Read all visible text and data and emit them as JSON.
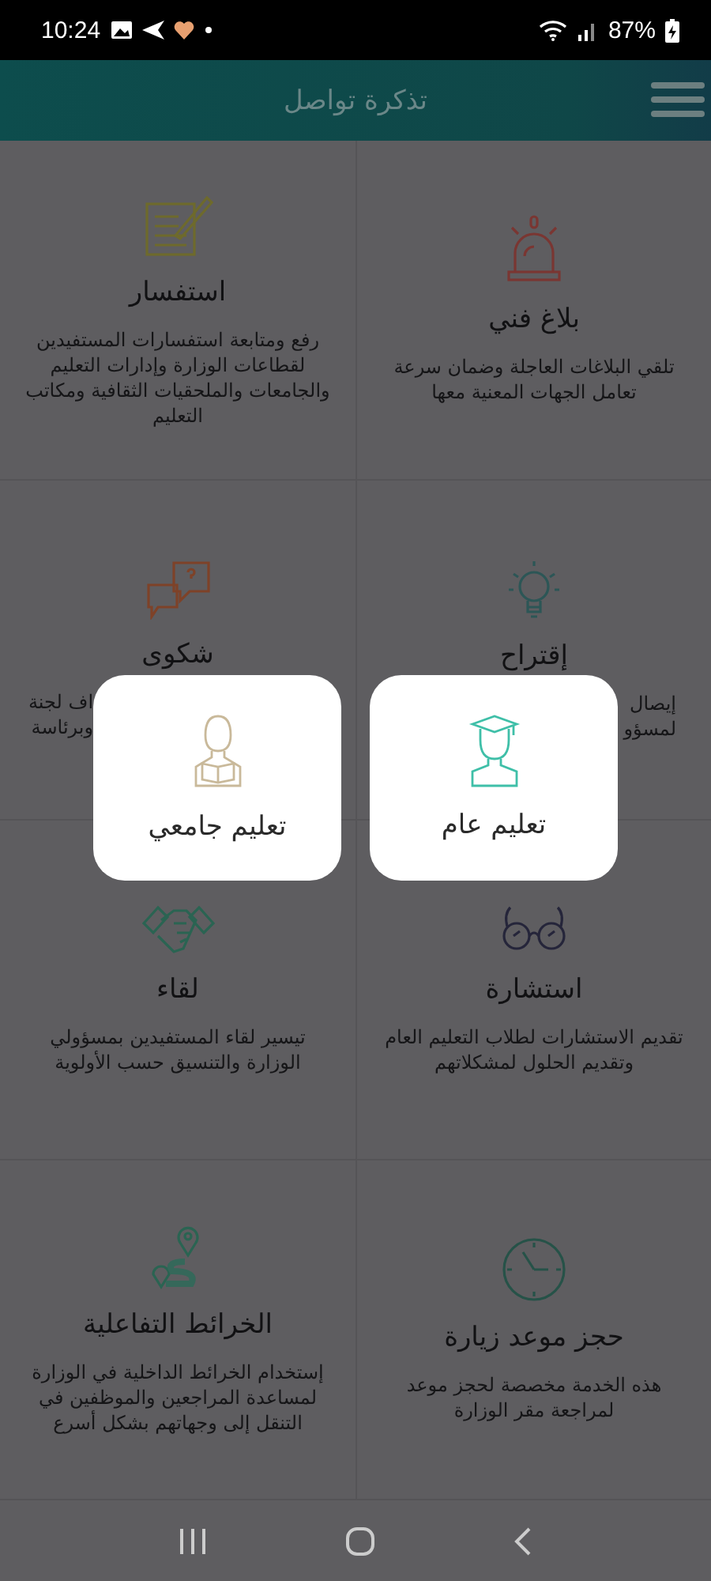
{
  "status_bar": {
    "time": "10:24",
    "battery": "87%"
  },
  "header": {
    "title": "تذكرة تواصل"
  },
  "services": [
    {
      "title": "بلاغ فني",
      "description": "تلقي البلاغات العاجلة وضمان سرعة تعامل الجهات المعنية معها",
      "kind": "full"
    },
    {
      "title": "استفسار",
      "description": "رفع ومتابعة استفسارات المستفيدين لقطاعات الوزارة وإدارات التعليم والجامعات والملحقيات الثقافية ومكاتب التعليم",
      "kind": "full"
    },
    {
      "title": "إقتراح",
      "description": "إيصال\nلمسؤو",
      "kind": "clipped"
    },
    {
      "title": "شكوى",
      "description": "اف لجنة\nوبرئاسة",
      "kind": "clipped"
    },
    {
      "title": "استشارة",
      "description": "تقديم الاستشارات لطلاب التعليم العام وتقديم الحلول لمشكلاتهم",
      "kind": "full"
    },
    {
      "title": "لقاء",
      "description": "تيسير لقاء المستفيدين بمسؤولي الوزارة والتنسيق حسب الأولوية",
      "kind": "full"
    },
    {
      "title": "حجز موعد زيارة",
      "description": "هذه الخدمة مخصصة لحجز موعد لمراجعة مقر الوزارة",
      "kind": "full"
    },
    {
      "title": "الخرائط التفاعلية",
      "description": "إستخدام الخرائط الداخلية في الوزارة لمساعدة المراجعين والموظفين في التنقل إلى وجهاتهم بشكل أسرع",
      "kind": "full"
    }
  ],
  "popup": {
    "options": [
      {
        "label": "تعليم عام"
      },
      {
        "label": "تعليم جامعي"
      }
    ]
  }
}
